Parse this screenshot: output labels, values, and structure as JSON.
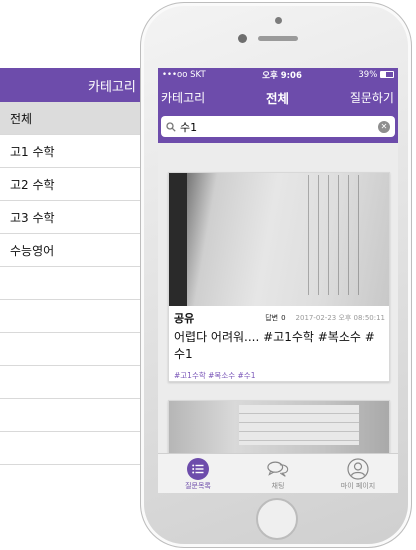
{
  "category_panel": {
    "header": "카테고리 선",
    "items": [
      "전체",
      "고1 수학",
      "고2 수학",
      "고3 수학",
      "수능영어",
      "",
      "",
      "",
      "",
      "",
      ""
    ]
  },
  "status_bar": {
    "carrier": "•••oo SKT",
    "time": "오후 9:06",
    "battery": "39%"
  },
  "nav": {
    "left": "카테고리",
    "title": "전체",
    "right": "질문하기"
  },
  "search": {
    "value": "수1",
    "placeholder": ""
  },
  "cards": [
    {
      "author": "공유",
      "answer_label": "답변",
      "answer_count": "0",
      "timestamp": "2017-02-23 오후 08:50:11",
      "body": "어렵다 어려워.... #고1수학 #복소수 #수1",
      "tags": "#고1수학 #복소수 #수1"
    }
  ],
  "tabs": [
    {
      "label": "질문목록",
      "icon": "list-icon",
      "active": true
    },
    {
      "label": "채팅",
      "icon": "chat-icon",
      "active": false
    },
    {
      "label": "마이 페이지",
      "icon": "person-icon",
      "active": false
    }
  ],
  "colors": {
    "accent": "#6d4cab",
    "tag": "#7a56b8"
  }
}
